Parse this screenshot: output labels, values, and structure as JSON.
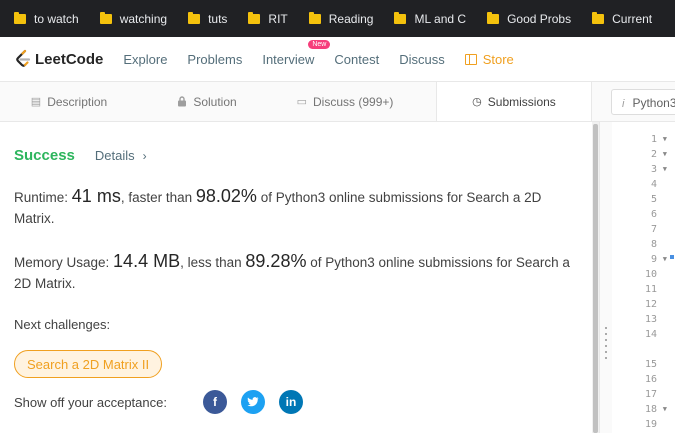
{
  "bookmarks": [
    "to watch",
    "watching",
    "tuts",
    "RIT",
    "Reading",
    "ML and C",
    "Good Probs",
    "Current"
  ],
  "nav": {
    "logo_text": "LeetCode",
    "items": [
      "Explore",
      "Problems",
      "Interview",
      "Contest",
      "Discuss"
    ],
    "interview_badge": "New",
    "store_label": "Store",
    "colors": {
      "store": "#f0a020",
      "badge": "#f63e7b"
    }
  },
  "tabs": [
    {
      "label": "Description",
      "icon": "description-icon"
    },
    {
      "label": "Solution",
      "icon": "lock-icon"
    },
    {
      "label": "Discuss (999+)",
      "icon": "comment-icon"
    },
    {
      "label": "Submissions",
      "icon": "clock-icon"
    }
  ],
  "editor": {
    "language": "Python3",
    "line_numbers": [
      "1",
      "2",
      "3",
      "4",
      "5",
      "6",
      "7",
      "8",
      "9",
      "10",
      "11",
      "12",
      "13",
      "14",
      "",
      "15",
      "16",
      "17",
      "18",
      "19"
    ],
    "fold_lines": [
      "1",
      "2",
      "3",
      "9",
      "18"
    ]
  },
  "result": {
    "status": "Success",
    "details_label": "Details",
    "runtime_label": "Runtime:",
    "runtime_value": "41 ms",
    "runtime_mid": ", faster than",
    "runtime_pct": "98.02%",
    "runtime_tail": "of Python3 online submissions for Search a 2D Matrix.",
    "memory_label": "Memory Usage:",
    "memory_value": "14.4 MB",
    "memory_mid": ", less than",
    "memory_pct": "89.28%",
    "memory_tail": "of Python3 online submissions for Search a 2D Matrix.",
    "next_label": "Next challenges:",
    "next_challenge": "Search a 2D Matrix II",
    "share_label": "Show off your acceptance:",
    "colors": {
      "success": "#2db55d",
      "chip": "#f0a020"
    }
  }
}
